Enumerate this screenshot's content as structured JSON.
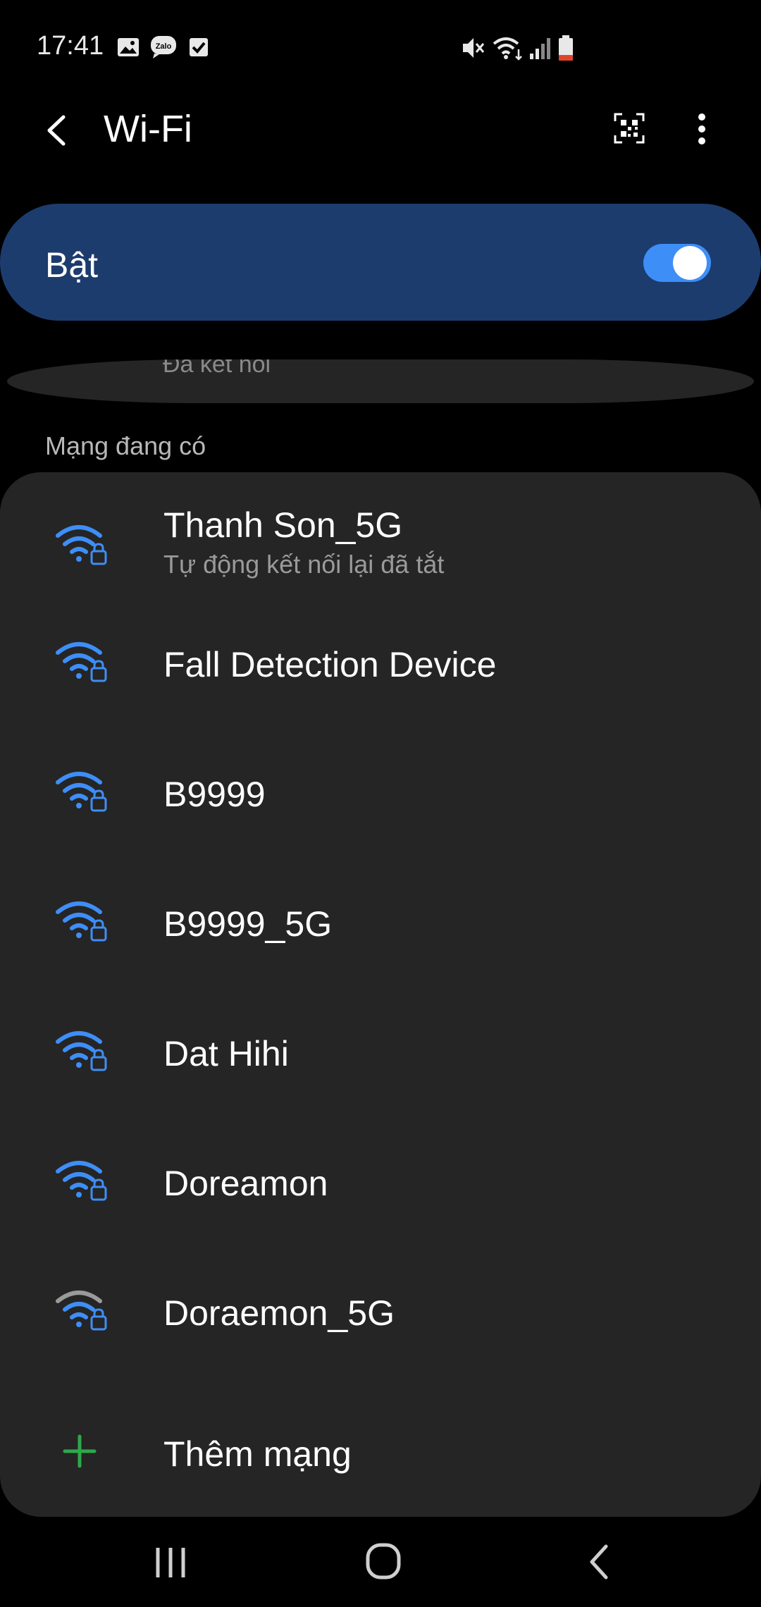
{
  "status_bar": {
    "time": "17:41",
    "left_icons": [
      "image-notification-icon",
      "zalo-icon",
      "checkbox-notification-icon"
    ],
    "right_icons": [
      "mute-icon",
      "wifi-signal-icon",
      "cell-signal-icon",
      "battery-icon"
    ]
  },
  "app_bar": {
    "title": "Wi-Fi",
    "back_icon": "back-arrow-icon",
    "qr_icon": "qr-scan-icon",
    "more_icon": "more-vertical-icon"
  },
  "main_switch": {
    "label": "Bật",
    "on": true,
    "accent_color": "#3e8ef7",
    "card_color": "#1c3c6e"
  },
  "connected": {
    "status": "Đã kết nối"
  },
  "section_header": "Mạng đang có",
  "networks": [
    {
      "name": "Thanh Son_5G",
      "subtitle": "Tự động kết nối lại đã tắt",
      "secured": true,
      "signal_color": "#3e8ef7"
    },
    {
      "name": "Fall Detection Device",
      "secured": true,
      "signal_color": "#3e8ef7"
    },
    {
      "name": "B9999",
      "secured": true,
      "signal_color": "#3e8ef7"
    },
    {
      "name": "B9999_5G",
      "secured": true,
      "signal_color": "#3e8ef7"
    },
    {
      "name": "Dat Hihi",
      "secured": true,
      "signal_color": "#3e8ef7"
    },
    {
      "name": "Doreamon",
      "secured": true,
      "signal_color": "#3e8ef7"
    },
    {
      "name": "Doraemon_5G",
      "secured": true,
      "signal_color": "#3e8ef7"
    }
  ],
  "add_network": {
    "label": "Thêm mạng",
    "icon": "plus-icon",
    "color": "#2ea84a"
  },
  "nav_bar": {
    "icons": [
      "recent-apps-icon",
      "home-icon",
      "back-icon"
    ]
  }
}
